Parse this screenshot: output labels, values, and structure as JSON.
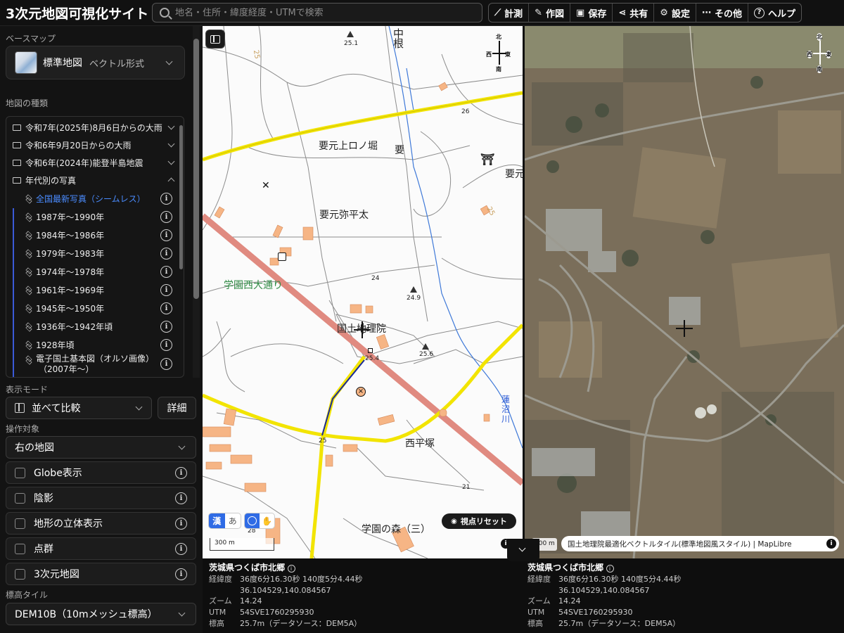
{
  "app": {
    "title": "3次元地図可視化サイト"
  },
  "search": {
    "placeholder": "地名・住所・緯度経度・UTMで検索"
  },
  "toolbar": [
    {
      "icon": "ruler-icon",
      "glyph": "⟋",
      "label": "計測"
    },
    {
      "icon": "pencil-icon",
      "glyph": "✎",
      "label": "作図"
    },
    {
      "icon": "save-icon",
      "glyph": "▣",
      "label": "保存"
    },
    {
      "icon": "share-icon",
      "glyph": "⋖",
      "label": "共有"
    },
    {
      "icon": "gear-icon",
      "glyph": "⚙",
      "label": "設定"
    },
    {
      "icon": "more-icon",
      "glyph": "⋯",
      "label": "その他"
    },
    {
      "icon": "help-icon",
      "glyph": "?",
      "label": "ヘルプ"
    }
  ],
  "sidebar": {
    "basemap_label": "ベースマップ",
    "basemap_name": "標準地図",
    "basemap_format": "ベクトル形式",
    "map_types_label": "地図の種類",
    "folders": [
      {
        "label": "令和7年(2025年)8月6日からの大雨",
        "expanded": false
      },
      {
        "label": "令和6年9月20日からの大雨",
        "expanded": false
      },
      {
        "label": "令和6年(2024年)能登半島地震",
        "expanded": false
      },
      {
        "label": "年代別の写真",
        "expanded": true
      }
    ],
    "layers": [
      {
        "label": "全国最新写真（シームレス）",
        "active": true
      },
      {
        "label": "1987年～1990年",
        "active": false
      },
      {
        "label": "1984年～1986年",
        "active": false
      },
      {
        "label": "1979年～1983年",
        "active": false
      },
      {
        "label": "1974年～1978年",
        "active": false
      },
      {
        "label": "1961年～1969年",
        "active": false
      },
      {
        "label": "1945年～1950年",
        "active": false
      },
      {
        "label": "1936年～1942年頃",
        "active": false
      },
      {
        "label": "1928年頃",
        "active": false
      },
      {
        "label": "電子国土基本図（オルソ画像）",
        "sub": "（2007年～）",
        "active": false
      }
    ],
    "display_mode_label": "表示モード",
    "display_mode_value": "並べて比較",
    "detail_button": "詳細",
    "target_label": "操作対象",
    "target_value": "右の地図",
    "options": [
      {
        "label": "Globe表示",
        "checked": false,
        "info": true
      },
      {
        "label": "陰影",
        "checked": false,
        "info": true
      },
      {
        "label": "地形の立体表示",
        "checked": false,
        "info": true
      },
      {
        "label": "点群",
        "checked": false,
        "info": true
      },
      {
        "label": "3次元地図",
        "checked": false,
        "info": true
      }
    ],
    "elevation_label": "標高タイル",
    "elevation_value": "DEM10B（10mメッシュ標高）"
  },
  "map_left": {
    "labels": {
      "naka": "中",
      "ne": "根",
      "kanamoto_kami": "要元上ロノ堀",
      "kaname": "要",
      "kanamotoR": "要元",
      "yahei": "要元弥平太",
      "gakuen_dori": "学園西大通り",
      "gsi": "国土地理院",
      "nishihira": "西平塚",
      "gakuen_mori": "学園の森（三）",
      "hasunuma1": "蓮",
      "hasunuma2": "沼",
      "hasunuma3": "川"
    },
    "elev": {
      "e251": "25.1",
      "e26": "26",
      "e24": "24",
      "e249": "24.9",
      "e256": "25.6",
      "e254": "25.4",
      "e25a": "25",
      "e25b": "25",
      "e21": "21",
      "e28": "28",
      "e25c": "25"
    },
    "compass": {
      "n": "北",
      "w": "西",
      "e": "東",
      "s": "南"
    },
    "scale": "300 m",
    "kanji_toggle": "漢",
    "kana_toggle": "あ",
    "reset_view": "視点リセット"
  },
  "map_right": {
    "compass": {
      "n": "北",
      "w": "西",
      "e": "東",
      "s": "南"
    },
    "scale": "300 m",
    "attribution": "国土地理院最適化ベクトルタイル(標準地図風スタイル) | MapLibre"
  },
  "info_left": {
    "address": "茨城県つくば市北郷",
    "latlon_key": "経緯度",
    "latlon_dms": "36度6分16.30秒 140度5分4.44秒",
    "latlon_dec": "36.104529,140.084567",
    "zoom_key": "ズーム",
    "zoom": "14.24",
    "utm_key": "UTM",
    "utm": "54SVE1760295930",
    "elev_key": "標高",
    "elev": "25.7m（データソース：DEM5A）"
  },
  "info_right": {
    "address": "茨城県つくば市北郷",
    "latlon_key": "経緯度",
    "latlon_dms": "36度6分16.30秒 140度5分4.44秒",
    "latlon_dec": "36.104529,140.084567",
    "zoom_key": "ズーム",
    "zoom": "14.24",
    "utm_key": "UTM",
    "utm": "54SVE1760295930",
    "elev_key": "標高",
    "elev": "25.7m（データソース：DEM5A）"
  },
  "colors": {
    "accent": "#3b82f6",
    "road_yellow": "#f2e400",
    "road_red": "#e0857c",
    "building": "#f6b585",
    "water": "#3a6fd8"
  }
}
